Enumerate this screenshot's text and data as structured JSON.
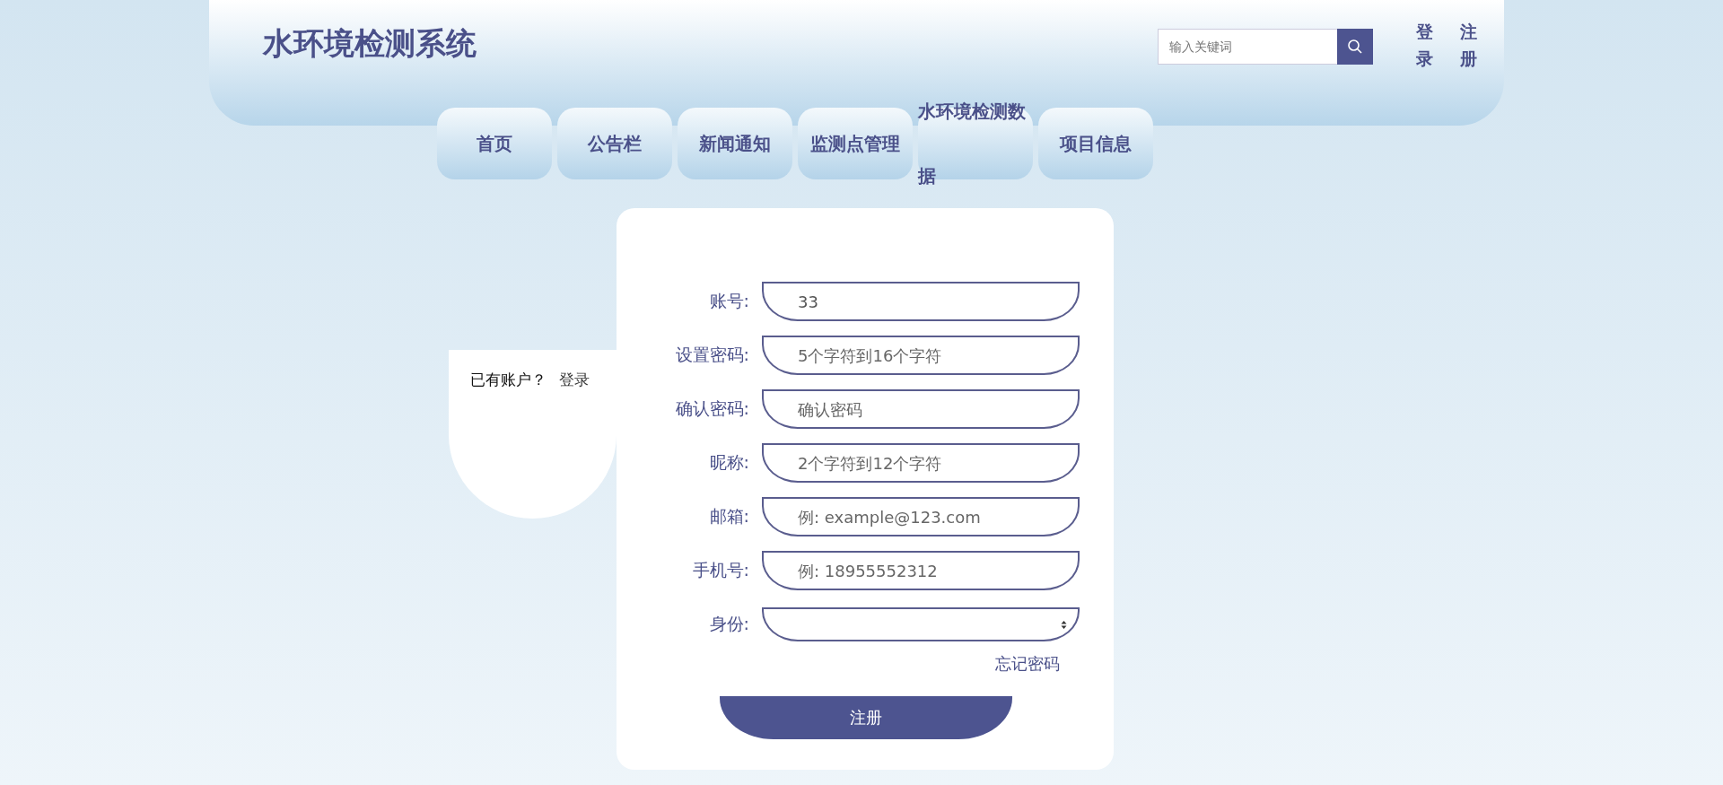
{
  "header": {
    "title": "水环境检测系统",
    "search": {
      "placeholder": "输入关键词"
    },
    "auth_links": [
      {
        "label": "登录"
      },
      {
        "label": "注册"
      }
    ]
  },
  "nav": [
    {
      "label": "首页"
    },
    {
      "label": "公告栏"
    },
    {
      "label": "新闻通知"
    },
    {
      "label": "监测点管理"
    },
    {
      "label": "水环境检测数据"
    },
    {
      "label": "项目信息"
    }
  ],
  "login_prompt": {
    "text": "已有账户？",
    "link": "登录"
  },
  "form": {
    "fields": [
      {
        "label": "账号:",
        "kind": "text",
        "value": "33"
      },
      {
        "label": "设置密码:",
        "kind": "text",
        "placeholder": "5个字符到16个字符"
      },
      {
        "label": "确认密码:",
        "kind": "text",
        "placeholder": "确认密码"
      },
      {
        "label": "昵称:",
        "kind": "text",
        "placeholder": "2个字符到12个字符"
      },
      {
        "label": "邮箱:",
        "kind": "text",
        "placeholder": "例: example@123.com"
      },
      {
        "label": "手机号:",
        "kind": "text",
        "placeholder": "例: 18955552312"
      },
      {
        "label": "身份:",
        "kind": "select"
      }
    ],
    "forgot_link": "忘记密码",
    "submit": "注册"
  }
}
